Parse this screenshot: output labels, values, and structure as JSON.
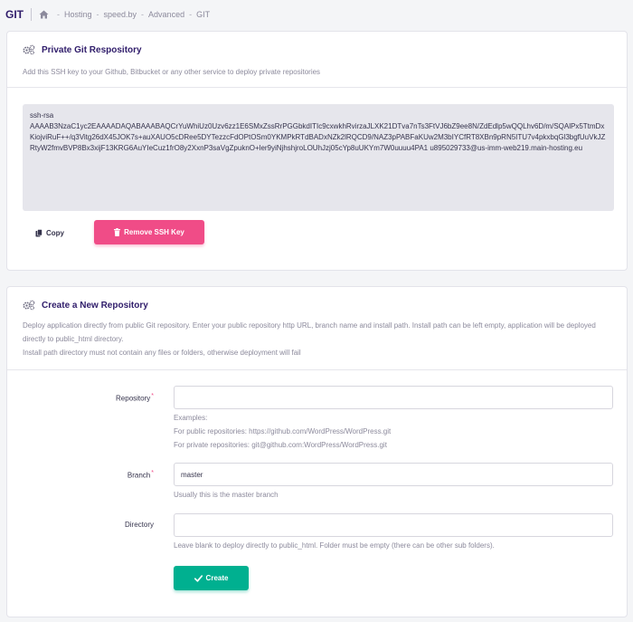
{
  "breadcrumb": {
    "title": "GIT",
    "items": [
      "Hosting",
      "speed.by",
      "Advanced",
      "GIT"
    ],
    "separator": "-"
  },
  "ssh_section": {
    "title": "Private Git Respository",
    "description": "Add this SSH key to your Github, Bitbucket or any other service to deploy private repositories",
    "key_lines": [
      "ssh-rsa",
      "AAAAB3NzaC1yc2EAAAADAQABAAABAQCrYuWhiUz0Uzv6zz1E6SMxZssRrPGGbkdITIc9cxwkhRvirzaJLXK21DTva7nTs3FtVJ6bZ9ee8N/ZdEdlp5wQQLhv6D/m/SQAlPx5TtmDxKiojviRuF++/q3Vitg26dX45JOK7s+auXAUO5cDRee5DYTezzcFdOPtOSm0YKMPkRTdBADxNZk2lRQCD9/NAZ3pPABFaKUw2M3bIYCfRT8XBn9pRN5ITU7v4pkxbqGl3bgfUuVkJZRtyW2fmvBVP8Bx3xijF13KRG6AuYIeCuz1frO8y2XxnP3saVgZpuknO+ler9yiNjhshjroLOUhJzj05cYp8uUKYm7W0uuuu4PA1 u895029733@us-imm-web219.main-hosting.eu"
    ],
    "copy_label": "Copy",
    "remove_label": "Remove SSH Key"
  },
  "repo_section": {
    "title": "Create a New Repository",
    "description_lines": [
      "Deploy application directly from public Git repository. Enter your public repository http URL, branch name and install path. Install path can be left empty, application will be deployed directly to public_html directory.",
      "Install path directory must not contain any files or folders, otherwise deployment will fail"
    ],
    "fields": {
      "repository": {
        "label": "Repository",
        "required": "*",
        "value": "",
        "help_lines": [
          "Examples:",
          "For public repositories: https://github.com/WordPress/WordPress.git",
          "For private repositories: git@github.com:WordPress/WordPress.git"
        ]
      },
      "branch": {
        "label": "Branch",
        "required": "*",
        "value": "master",
        "help": "Usually this is the master branch"
      },
      "directory": {
        "label": "Directory",
        "value": "",
        "help": "Leave blank to deploy directly to public_html. Folder must be empty (there can be other sub folders)."
      }
    },
    "create_label": "Create"
  },
  "icons": {
    "home": "home-icon",
    "gears": "gears-icon",
    "copy": "copy-icon",
    "trash": "trash-icon",
    "check": "check-icon"
  },
  "colors": {
    "brand_dark": "#2f1c6a",
    "danger": "#f04c87",
    "success": "#00b090",
    "muted_text": "#8c8a9c",
    "ssh_box_bg": "#e6e6ec"
  }
}
